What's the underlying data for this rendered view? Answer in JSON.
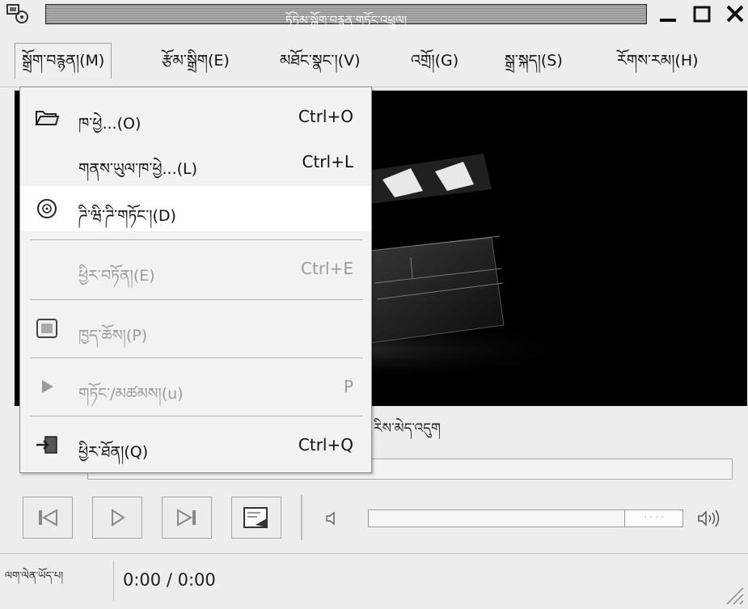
{
  "window": {
    "title": "ཏོཏེམ་སྒྲོག་བརྙན་གཏོང་འཕྲུལ།",
    "minimize_glyph": "_",
    "maximize_glyph": "□",
    "close_glyph": "✕"
  },
  "menubar": {
    "items": [
      {
        "label": "སྒྲོག་བརྙན།(M)"
      },
      {
        "label": "རྩོམ་སྒྲིག(E)"
      },
      {
        "label": "མཐོང་སྣང་།(V)"
      },
      {
        "label": "འགྲོ།(G)"
      },
      {
        "label": "སྒྲ་སྐད།(S)"
      },
      {
        "label": "རོགས་རམ།(H)"
      }
    ]
  },
  "file_menu": {
    "items": [
      {
        "label": "ཁ་ཕྱེ...(O)",
        "accel": "Ctrl+O",
        "icon": "folder-open-icon",
        "enabled": true
      },
      {
        "label": "གནས་ཡུལ་ཁ་ཕྱེ...(L)",
        "accel": "Ctrl+L",
        "icon": "",
        "enabled": true
      },
      {
        "label": "ཌི་ཝི་ཌི་གཏོང་།(D)",
        "accel": "",
        "icon": "disc-icon",
        "enabled": true
      },
      {
        "label": "ཕྱིར་བཏོན།(E)",
        "accel": "Ctrl+E",
        "icon": "",
        "enabled": false
      },
      {
        "label": "ཁྱད་ཆོས།(P)",
        "accel": "",
        "icon": "properties-icon",
        "enabled": false
      },
      {
        "label": "གཏོང་/མཚམས།(u)",
        "accel": "P",
        "icon": "play-icon",
        "enabled": false
      },
      {
        "label": "ཕྱིར་ཐོན།(Q)",
        "accel": "Ctrl+Q",
        "icon": "quit-icon",
        "enabled": true
      }
    ]
  },
  "player": {
    "status_text": "ས་ཁོངས་མེད་པ། འགྲུལ་བཞུད་ལ་བཀོད་ན་ མེད་འདུག",
    "status_visible": "རིས་མེད་འདུག",
    "volume_thumb_text": "· · · ·"
  },
  "statusbar": {
    "label": "ལག་ལེན་ཡོད་པ།",
    "time": "0:00 / 0:00"
  }
}
